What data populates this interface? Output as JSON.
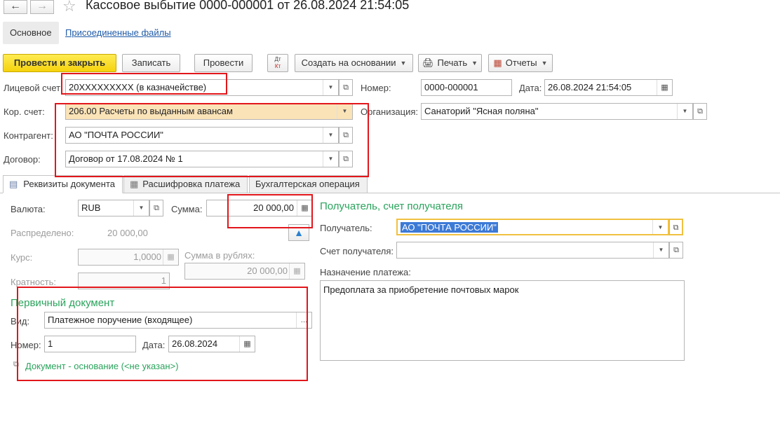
{
  "window": {
    "back_icon": "arrow-left-icon",
    "forward_icon": "arrow-right-icon",
    "title": "Кассовое выбытие 0000-000001 от 26.08.2024 21:54:05"
  },
  "top_tabs": {
    "main": "Основное",
    "attached": "Присоединенные файлы"
  },
  "toolbar": {
    "post_close": "Провести и закрыть",
    "save": "Записать",
    "post": "Провести",
    "dt_kt_top": "Дт",
    "dt_kt_bottom": "Кт",
    "create_based": "Создать на основании",
    "print": "Печать",
    "reports": "Отчеты"
  },
  "header": {
    "account_label": "Лицевой счет:",
    "account_value": "20XXXXXXXXX (в казначействе)",
    "number_label": "Номер:",
    "number_value": "0000-000001",
    "date_label": "Дата:",
    "date_value": "26.08.2024 21:54:05",
    "corr_label": "Кор. счет:",
    "corr_value": "206.00 Расчеты по выданным авансам",
    "org_label": "Организация:",
    "org_value": "Санаторий \"Ясная поляна\"",
    "counterparty_label": "Контрагент:",
    "counterparty_value": "АО \"ПОЧТА РОССИИ\"",
    "contract_label": "Договор:",
    "contract_value": "Договор от 17.08.2024 № 1"
  },
  "doc_tabs": [
    "Реквизиты документа",
    "Расшифровка платежа",
    "Бухгалтерская операция"
  ],
  "requisites": {
    "currency_label": "Валюта:",
    "currency_value": "RUB",
    "sum_label": "Сумма:",
    "sum_value": "20 000,00",
    "distributed_label": "Распределено:",
    "distributed_value": "20 000,00",
    "rate_label": "Курс:",
    "rate_value": "1,0000",
    "rub_sum_label": "Сумма в рублях:",
    "rub_sum_value": "20 000,00",
    "multiplicity_label": "Кратность:",
    "multiplicity_value": "1"
  },
  "primary_doc": {
    "section_title": "Первичный документ",
    "kind_label": "Вид:",
    "kind_value": "Платежное поручение (входящее)",
    "number_label": "Номер:",
    "number_value": "1",
    "date_label": "Дата:",
    "date_value": "26.08.2024",
    "basis_link": "Документ - основание (<не указан>)"
  },
  "recipient": {
    "section_title": "Получатель, счет получателя",
    "recipient_label": "Получатель:",
    "recipient_value": "АО \"ПОЧТА РОССИИ\"",
    "account_label": "Счет получателя:",
    "account_value": "",
    "purpose_label": "Назначение платежа:",
    "purpose_value": "Предоплата за приобретение почтовых марок"
  },
  "colors": {
    "primary_button": "#f5d20c",
    "section": "#2aa35c",
    "annotation": "#e2161b",
    "focus": "#f0c040"
  }
}
